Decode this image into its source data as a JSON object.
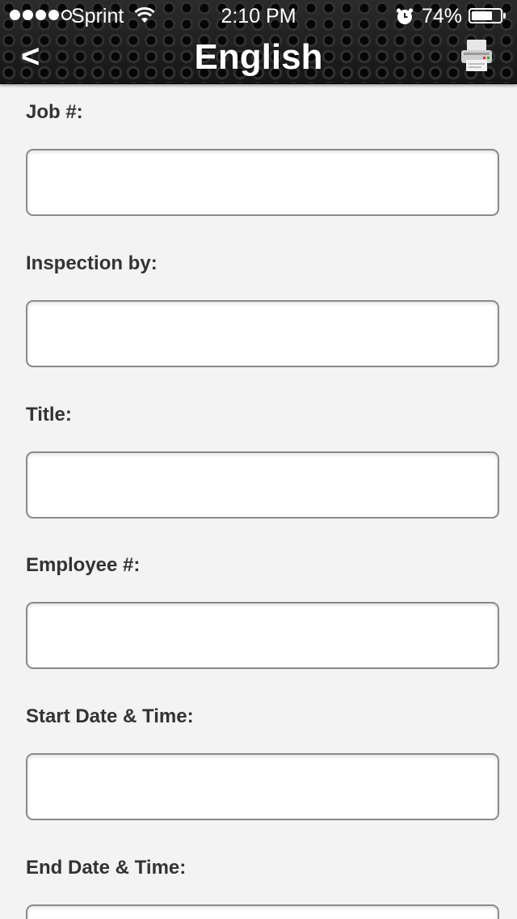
{
  "status_bar": {
    "carrier": "Sprint",
    "time": "2:10 PM",
    "battery_percent": "74%",
    "battery_level": 0.74,
    "signal_bars_filled": 4,
    "signal_bars_total": 5,
    "icons": [
      "wifi-icon",
      "alarm-icon",
      "battery-icon"
    ]
  },
  "nav": {
    "back_label": "<",
    "title": "English",
    "print_icon": "printer-icon"
  },
  "form": {
    "fields": [
      {
        "label": "Job #:",
        "value": "",
        "placeholder": ""
      },
      {
        "label": "Inspection by:",
        "value": "",
        "placeholder": ""
      },
      {
        "label": "Title:",
        "value": "",
        "placeholder": ""
      },
      {
        "label": "Employee #:",
        "value": "",
        "placeholder": ""
      },
      {
        "label": "Start Date & Time:",
        "value": "",
        "placeholder": ""
      },
      {
        "label": "End Date & Time:",
        "value": "",
        "placeholder": ""
      }
    ]
  },
  "colors": {
    "header_bg": "#1c1c1c",
    "page_bg": "#f3f3f3",
    "label_text": "#333333",
    "input_border": "#8a8a8a"
  }
}
